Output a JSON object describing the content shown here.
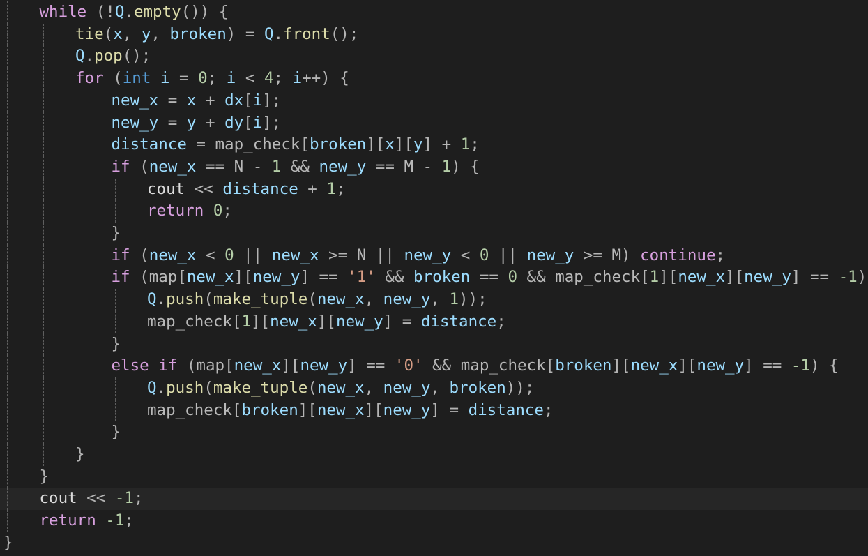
{
  "colors": {
    "background": "#1e1e1e",
    "current_line": "#262626",
    "keyword": "#d8a0df",
    "type_keyword": "#569cd6",
    "variable": "#9cdcfe",
    "global_variable": "#b9b9b9",
    "function": "#dcdcaa",
    "number": "#b5cea8",
    "char_literal": "#d69d85",
    "operator": "#b4b4b4",
    "plain_text": "#dcdcdc",
    "indent_guide": "#5f5f5f"
  },
  "code_lines": [
    {
      "indent": 1,
      "tokens": [
        {
          "t": "while",
          "c": "kw"
        },
        {
          "t": " (!",
          "c": "op"
        },
        {
          "t": "Q",
          "c": "var"
        },
        {
          "t": ".",
          "c": "op"
        },
        {
          "t": "empty",
          "c": "fn"
        },
        {
          "t": "()) {",
          "c": "op"
        }
      ]
    },
    {
      "indent": 2,
      "tokens": [
        {
          "t": "tie",
          "c": "fn"
        },
        {
          "t": "(",
          "c": "op"
        },
        {
          "t": "x",
          "c": "var"
        },
        {
          "t": ", ",
          "c": "op"
        },
        {
          "t": "y",
          "c": "var"
        },
        {
          "t": ", ",
          "c": "op"
        },
        {
          "t": "broken",
          "c": "var"
        },
        {
          "t": ") = ",
          "c": "op"
        },
        {
          "t": "Q",
          "c": "var"
        },
        {
          "t": ".",
          "c": "op"
        },
        {
          "t": "front",
          "c": "fn"
        },
        {
          "t": "();",
          "c": "op"
        }
      ]
    },
    {
      "indent": 2,
      "tokens": [
        {
          "t": "Q",
          "c": "var"
        },
        {
          "t": ".",
          "c": "op"
        },
        {
          "t": "pop",
          "c": "fn"
        },
        {
          "t": "();",
          "c": "op"
        }
      ]
    },
    {
      "indent": 2,
      "tokens": [
        {
          "t": "for",
          "c": "kw"
        },
        {
          "t": " (",
          "c": "op"
        },
        {
          "t": "int",
          "c": "kt"
        },
        {
          "t": " ",
          "c": "op"
        },
        {
          "t": "i",
          "c": "var"
        },
        {
          "t": " = ",
          "c": "op"
        },
        {
          "t": "0",
          "c": "num"
        },
        {
          "t": "; ",
          "c": "op"
        },
        {
          "t": "i",
          "c": "var"
        },
        {
          "t": " < ",
          "c": "op"
        },
        {
          "t": "4",
          "c": "num"
        },
        {
          "t": "; ",
          "c": "op"
        },
        {
          "t": "i",
          "c": "var"
        },
        {
          "t": "++) {",
          "c": "op"
        }
      ]
    },
    {
      "indent": 3,
      "tokens": [
        {
          "t": "new_x",
          "c": "var"
        },
        {
          "t": " = ",
          "c": "op"
        },
        {
          "t": "x",
          "c": "var"
        },
        {
          "t": " + ",
          "c": "op"
        },
        {
          "t": "dx",
          "c": "var"
        },
        {
          "t": "[",
          "c": "op"
        },
        {
          "t": "i",
          "c": "var"
        },
        {
          "t": "];",
          "c": "op"
        }
      ]
    },
    {
      "indent": 3,
      "tokens": [
        {
          "t": "new_y",
          "c": "var"
        },
        {
          "t": " = ",
          "c": "op"
        },
        {
          "t": "y",
          "c": "var"
        },
        {
          "t": " + ",
          "c": "op"
        },
        {
          "t": "dy",
          "c": "var"
        },
        {
          "t": "[",
          "c": "op"
        },
        {
          "t": "i",
          "c": "var"
        },
        {
          "t": "];",
          "c": "op"
        }
      ]
    },
    {
      "indent": 3,
      "tokens": [
        {
          "t": "distance",
          "c": "var"
        },
        {
          "t": " = ",
          "c": "op"
        },
        {
          "t": "map_check",
          "c": "gvar"
        },
        {
          "t": "[",
          "c": "op"
        },
        {
          "t": "broken",
          "c": "var"
        },
        {
          "t": "][",
          "c": "op"
        },
        {
          "t": "x",
          "c": "var"
        },
        {
          "t": "][",
          "c": "op"
        },
        {
          "t": "y",
          "c": "var"
        },
        {
          "t": "] + ",
          "c": "op"
        },
        {
          "t": "1",
          "c": "num"
        },
        {
          "t": ";",
          "c": "op"
        }
      ]
    },
    {
      "indent": 3,
      "tokens": [
        {
          "t": "if",
          "c": "kw"
        },
        {
          "t": " (",
          "c": "op"
        },
        {
          "t": "new_x",
          "c": "var"
        },
        {
          "t": " == ",
          "c": "op"
        },
        {
          "t": "N",
          "c": "gvar"
        },
        {
          "t": " - ",
          "c": "op"
        },
        {
          "t": "1",
          "c": "num"
        },
        {
          "t": " && ",
          "c": "op"
        },
        {
          "t": "new_y",
          "c": "var"
        },
        {
          "t": " == ",
          "c": "op"
        },
        {
          "t": "M",
          "c": "gvar"
        },
        {
          "t": " - ",
          "c": "op"
        },
        {
          "t": "1",
          "c": "num"
        },
        {
          "t": ") {",
          "c": "op"
        }
      ]
    },
    {
      "indent": 4,
      "tokens": [
        {
          "t": "cout",
          "c": "plain"
        },
        {
          "t": " << ",
          "c": "op"
        },
        {
          "t": "distance",
          "c": "var"
        },
        {
          "t": " + ",
          "c": "op"
        },
        {
          "t": "1",
          "c": "num"
        },
        {
          "t": ";",
          "c": "op"
        }
      ]
    },
    {
      "indent": 4,
      "tokens": [
        {
          "t": "return",
          "c": "kw"
        },
        {
          "t": " ",
          "c": "op"
        },
        {
          "t": "0",
          "c": "num"
        },
        {
          "t": ";",
          "c": "op"
        }
      ]
    },
    {
      "indent": 3,
      "tokens": [
        {
          "t": "}",
          "c": "op"
        }
      ]
    },
    {
      "indent": 3,
      "tokens": [
        {
          "t": "if",
          "c": "kw"
        },
        {
          "t": " (",
          "c": "op"
        },
        {
          "t": "new_x",
          "c": "var"
        },
        {
          "t": " < ",
          "c": "op"
        },
        {
          "t": "0",
          "c": "num"
        },
        {
          "t": " || ",
          "c": "op"
        },
        {
          "t": "new_x",
          "c": "var"
        },
        {
          "t": " >= ",
          "c": "op"
        },
        {
          "t": "N",
          "c": "gvar"
        },
        {
          "t": " || ",
          "c": "op"
        },
        {
          "t": "new_y",
          "c": "var"
        },
        {
          "t": " < ",
          "c": "op"
        },
        {
          "t": "0",
          "c": "num"
        },
        {
          "t": " || ",
          "c": "op"
        },
        {
          "t": "new_y",
          "c": "var"
        },
        {
          "t": " >= ",
          "c": "op"
        },
        {
          "t": "M",
          "c": "gvar"
        },
        {
          "t": ") ",
          "c": "op"
        },
        {
          "t": "continue",
          "c": "kw"
        },
        {
          "t": ";",
          "c": "op"
        }
      ]
    },
    {
      "indent": 3,
      "tokens": [
        {
          "t": "if",
          "c": "kw"
        },
        {
          "t": " (",
          "c": "op"
        },
        {
          "t": "map",
          "c": "gvar"
        },
        {
          "t": "[",
          "c": "op"
        },
        {
          "t": "new_x",
          "c": "var"
        },
        {
          "t": "][",
          "c": "op"
        },
        {
          "t": "new_y",
          "c": "var"
        },
        {
          "t": "] == ",
          "c": "op"
        },
        {
          "t": "'1'",
          "c": "chr"
        },
        {
          "t": " && ",
          "c": "op"
        },
        {
          "t": "broken",
          "c": "var"
        },
        {
          "t": " == ",
          "c": "op"
        },
        {
          "t": "0",
          "c": "num"
        },
        {
          "t": " && ",
          "c": "op"
        },
        {
          "t": "map_check",
          "c": "gvar"
        },
        {
          "t": "[",
          "c": "op"
        },
        {
          "t": "1",
          "c": "num"
        },
        {
          "t": "][",
          "c": "op"
        },
        {
          "t": "new_x",
          "c": "var"
        },
        {
          "t": "][",
          "c": "op"
        },
        {
          "t": "new_y",
          "c": "var"
        },
        {
          "t": "] == ",
          "c": "op"
        },
        {
          "t": "-1",
          "c": "num"
        },
        {
          "t": ") {",
          "c": "op"
        }
      ]
    },
    {
      "indent": 4,
      "tokens": [
        {
          "t": "Q",
          "c": "var"
        },
        {
          "t": ".",
          "c": "op"
        },
        {
          "t": "push",
          "c": "fn"
        },
        {
          "t": "(",
          "c": "op"
        },
        {
          "t": "make_tuple",
          "c": "fn"
        },
        {
          "t": "(",
          "c": "op"
        },
        {
          "t": "new_x",
          "c": "var"
        },
        {
          "t": ", ",
          "c": "op"
        },
        {
          "t": "new_y",
          "c": "var"
        },
        {
          "t": ", ",
          "c": "op"
        },
        {
          "t": "1",
          "c": "num"
        },
        {
          "t": "));",
          "c": "op"
        }
      ]
    },
    {
      "indent": 4,
      "tokens": [
        {
          "t": "map_check",
          "c": "gvar"
        },
        {
          "t": "[",
          "c": "op"
        },
        {
          "t": "1",
          "c": "num"
        },
        {
          "t": "][",
          "c": "op"
        },
        {
          "t": "new_x",
          "c": "var"
        },
        {
          "t": "][",
          "c": "op"
        },
        {
          "t": "new_y",
          "c": "var"
        },
        {
          "t": "] = ",
          "c": "op"
        },
        {
          "t": "distance",
          "c": "var"
        },
        {
          "t": ";",
          "c": "op"
        }
      ]
    },
    {
      "indent": 3,
      "tokens": [
        {
          "t": "}",
          "c": "op"
        }
      ]
    },
    {
      "indent": 3,
      "tokens": [
        {
          "t": "else",
          "c": "kw"
        },
        {
          "t": " ",
          "c": "op"
        },
        {
          "t": "if",
          "c": "kw"
        },
        {
          "t": " (",
          "c": "op"
        },
        {
          "t": "map",
          "c": "gvar"
        },
        {
          "t": "[",
          "c": "op"
        },
        {
          "t": "new_x",
          "c": "var"
        },
        {
          "t": "][",
          "c": "op"
        },
        {
          "t": "new_y",
          "c": "var"
        },
        {
          "t": "] == ",
          "c": "op"
        },
        {
          "t": "'0'",
          "c": "chr"
        },
        {
          "t": " && ",
          "c": "op"
        },
        {
          "t": "map_check",
          "c": "gvar"
        },
        {
          "t": "[",
          "c": "op"
        },
        {
          "t": "broken",
          "c": "var"
        },
        {
          "t": "][",
          "c": "op"
        },
        {
          "t": "new_x",
          "c": "var"
        },
        {
          "t": "][",
          "c": "op"
        },
        {
          "t": "new_y",
          "c": "var"
        },
        {
          "t": "] == ",
          "c": "op"
        },
        {
          "t": "-1",
          "c": "num"
        },
        {
          "t": ") {",
          "c": "op"
        }
      ]
    },
    {
      "indent": 4,
      "tokens": [
        {
          "t": "Q",
          "c": "var"
        },
        {
          "t": ".",
          "c": "op"
        },
        {
          "t": "push",
          "c": "fn"
        },
        {
          "t": "(",
          "c": "op"
        },
        {
          "t": "make_tuple",
          "c": "fn"
        },
        {
          "t": "(",
          "c": "op"
        },
        {
          "t": "new_x",
          "c": "var"
        },
        {
          "t": ", ",
          "c": "op"
        },
        {
          "t": "new_y",
          "c": "var"
        },
        {
          "t": ", ",
          "c": "op"
        },
        {
          "t": "broken",
          "c": "var"
        },
        {
          "t": "));",
          "c": "op"
        }
      ]
    },
    {
      "indent": 4,
      "tokens": [
        {
          "t": "map_check",
          "c": "gvar"
        },
        {
          "t": "[",
          "c": "op"
        },
        {
          "t": "broken",
          "c": "var"
        },
        {
          "t": "][",
          "c": "op"
        },
        {
          "t": "new_x",
          "c": "var"
        },
        {
          "t": "][",
          "c": "op"
        },
        {
          "t": "new_y",
          "c": "var"
        },
        {
          "t": "] = ",
          "c": "op"
        },
        {
          "t": "distance",
          "c": "var"
        },
        {
          "t": ";",
          "c": "op"
        }
      ]
    },
    {
      "indent": 3,
      "tokens": [
        {
          "t": "}",
          "c": "op"
        }
      ]
    },
    {
      "indent": 2,
      "tokens": [
        {
          "t": "}",
          "c": "op"
        }
      ]
    },
    {
      "indent": 1,
      "tokens": [
        {
          "t": "}",
          "c": "op"
        }
      ]
    },
    {
      "indent": 1,
      "current": true,
      "tokens": [
        {
          "t": "cout",
          "c": "plain"
        },
        {
          "t": " << ",
          "c": "op"
        },
        {
          "t": "-1",
          "c": "num"
        },
        {
          "t": ";",
          "c": "op"
        }
      ]
    },
    {
      "indent": 1,
      "tokens": [
        {
          "t": "return",
          "c": "kw"
        },
        {
          "t": " ",
          "c": "op"
        },
        {
          "t": "-1",
          "c": "num"
        },
        {
          "t": ";",
          "c": "op"
        }
      ]
    },
    {
      "indent": 0,
      "tokens": [
        {
          "t": "}",
          "c": "op"
        }
      ]
    }
  ]
}
